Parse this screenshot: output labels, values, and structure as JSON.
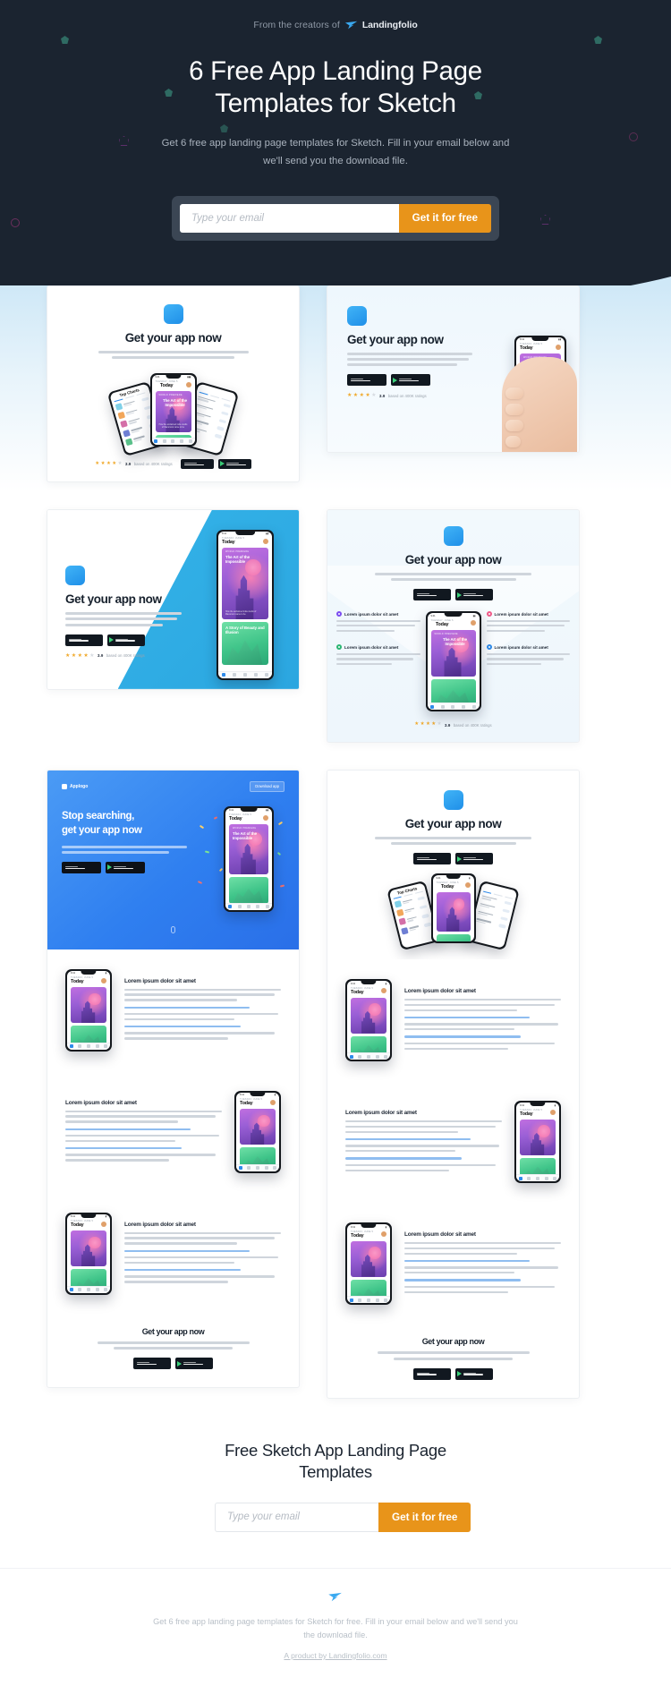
{
  "hero": {
    "creators_prefix": "From the creators of",
    "brand": "Landingfolio",
    "title": "6 Free App Landing Page Templates for Sketch",
    "subtitle": "Get 6 free app landing page templates for Sketch. Fill in your email below and we'll send you the download file.",
    "email_placeholder": "Type your email",
    "email_value": "",
    "cta_label": "Get it for free"
  },
  "template_common": {
    "heading": "Get your app now",
    "app_store_top": "Download on the",
    "app_store_name": "App Store",
    "play_top": "GET IT ON",
    "play_name": "Google Play",
    "rating_value": "3.9",
    "rating_caption": "based on 400K ratings",
    "stars_filled": 4,
    "stars_total": 5,
    "phone_date": "TUESDAY, JUNE 5",
    "phone_title": "Today",
    "card_eyebrow": "WORLD PREMIERE",
    "card_title": "The Art of the Impossible",
    "card_foot": "How the acclaimed indie studio of Macumoni came to be",
    "card2_title": "A Story of Beauty and Illusion",
    "list_title": "Top Charts"
  },
  "templates": [
    {
      "id": 1,
      "name": "centered-fan-template",
      "layout": "centered"
    },
    {
      "id": 2,
      "name": "hand-holding-phone-template",
      "layout": "split-left"
    },
    {
      "id": 3,
      "name": "diagonal-blue-template",
      "layout": "diagonal"
    },
    {
      "id": 4,
      "name": "feature-grid-template",
      "layout": "features"
    },
    {
      "id": 5,
      "name": "long-blue-hero-template",
      "layout": "long"
    },
    {
      "id": 6,
      "name": "long-light-hero-template",
      "layout": "long"
    }
  ],
  "template5": {
    "logo_label": "Applogo",
    "download_label": "Download app",
    "headline_line1": "Stop searching,",
    "headline_line2": "get your app now"
  },
  "feature_cards": [
    {
      "title": "Lorem ipsum dolor sit amet",
      "color": "#7b4df0"
    },
    {
      "title": "Lorem ipsum dolor sit amet",
      "color": "#f05b8a"
    },
    {
      "title": "Lorem ipsum dolor sit amet",
      "color": "#2bb673"
    },
    {
      "title": "Lorem ipsum dolor sit amet",
      "color": "#2f8bea"
    }
  ],
  "feature_rows": [
    {
      "title": "Lorem ipsum dolor sit amet"
    },
    {
      "title": "Lorem ipsum dolor sit amet"
    },
    {
      "title": "Lorem ipsum dolor sit amet"
    }
  ],
  "bottom": {
    "title": "Free Sketch App Landing Page Templates",
    "email_placeholder": "Type your email",
    "email_value": "",
    "cta_label": "Get it for free"
  },
  "footer": {
    "text": "Get 6 free app landing page templates for Sketch for free. Fill in your email below and we'll send you the download file.",
    "link": "A product by Landingfolio.com"
  },
  "colors": {
    "hero_bg": "#1b2430",
    "accent_orange": "#e8941a",
    "accent_blue": "#2f8bea",
    "star": "#f0a92b"
  }
}
